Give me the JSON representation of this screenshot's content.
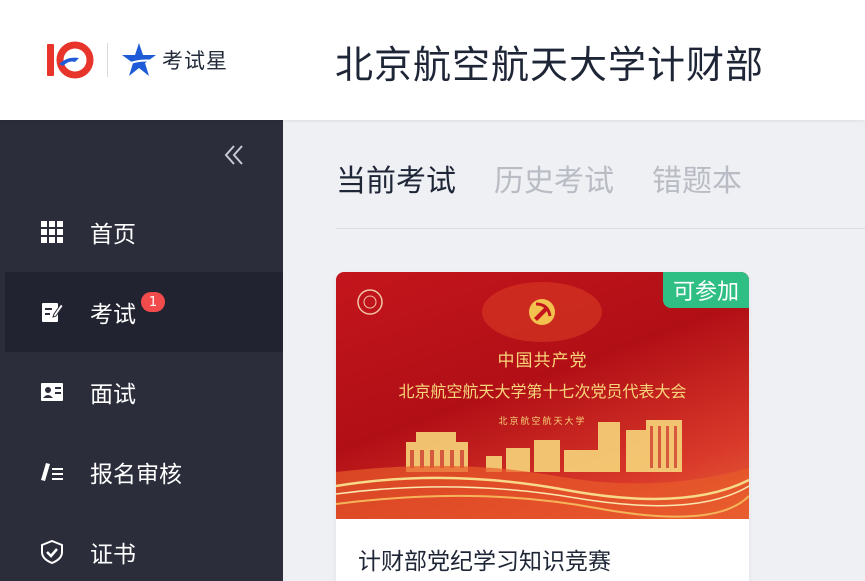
{
  "header": {
    "brand_text": "考试星",
    "org_name": "北京航空航天大学计财部"
  },
  "sidebar": {
    "collapse_icon": "double-chevron-left-icon",
    "items": [
      {
        "label": "首页",
        "icon": "grid-icon",
        "active": false
      },
      {
        "label": "考试",
        "icon": "edit-note-icon",
        "active": true,
        "badge": "1"
      },
      {
        "label": "面试",
        "icon": "id-card-icon",
        "active": false
      },
      {
        "label": "报名审核",
        "icon": "pen-list-icon",
        "active": false
      },
      {
        "label": "证书",
        "icon": "shield-check-icon",
        "active": false
      }
    ]
  },
  "tabs": [
    {
      "label": "当前考试",
      "active": true
    },
    {
      "label": "历史考试",
      "active": false
    },
    {
      "label": "错题本",
      "active": false
    }
  ],
  "exam_card": {
    "status": "可参加",
    "title": "计财部党纪学习知识竞赛",
    "banner": {
      "line1": "中国共产党",
      "line2": "北京航空航天大学第十七次党员代表大会",
      "line3": "北京航空航天大学"
    }
  },
  "colors": {
    "sidebar_bg": "#2b2d3b",
    "sidebar_active_bg": "#222330",
    "badge_red": "#f24b4b",
    "status_green": "#2fbf84",
    "banner_red": "#c4151c",
    "banner_gold": "#f7d57a",
    "brand_blue": "#1f5bd6",
    "brand_red": "#e8352c"
  }
}
